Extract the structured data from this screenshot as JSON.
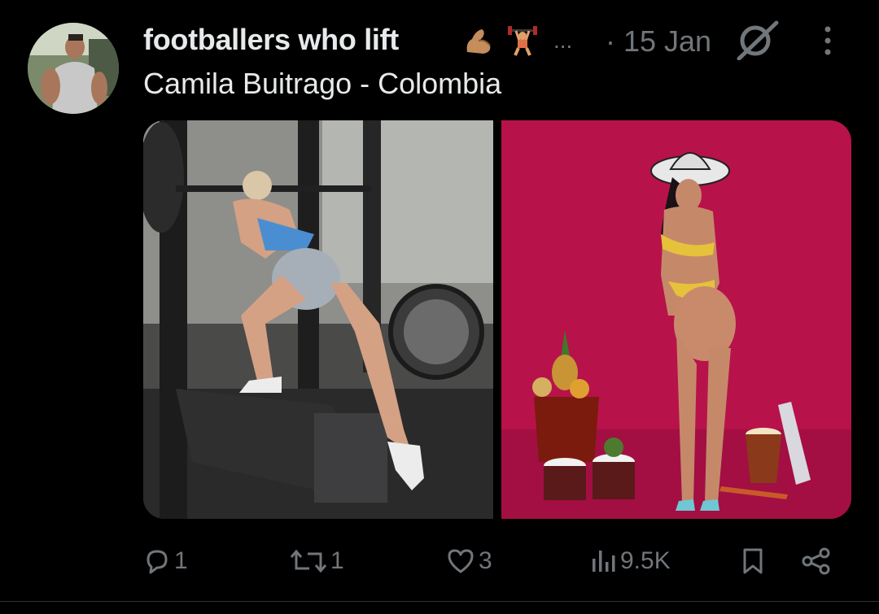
{
  "tweet": {
    "author_name": "footballers who lift",
    "author_emojis": [
      "flexed-biceps-emoji",
      "weightlifter-emoji"
    ],
    "truncation": "...",
    "date": "· 15 Jan",
    "text": "Camila Buitrago - Colombia"
  },
  "media": [
    {
      "description": "woman doing split squat at gym rack",
      "kind": "photo"
    },
    {
      "description": "woman in yellow bikini and hat against magenta backdrop",
      "kind": "photo"
    }
  ],
  "actions": {
    "reply_count": "1",
    "retweet_count": "1",
    "like_count": "3",
    "views_count": "9.5K"
  },
  "icons": {
    "reply": "reply-icon",
    "retweet": "retweet-icon",
    "like": "heart-icon",
    "views": "views-icon",
    "bookmark": "bookmark-icon",
    "share": "share-icon",
    "grok": "grok-icon",
    "more": "more-vertical-icon"
  },
  "colors": {
    "background": "#000000",
    "text_primary": "#e7e9ea",
    "text_secondary": "#71767b",
    "magenta_backdrop": "#b8124a"
  }
}
